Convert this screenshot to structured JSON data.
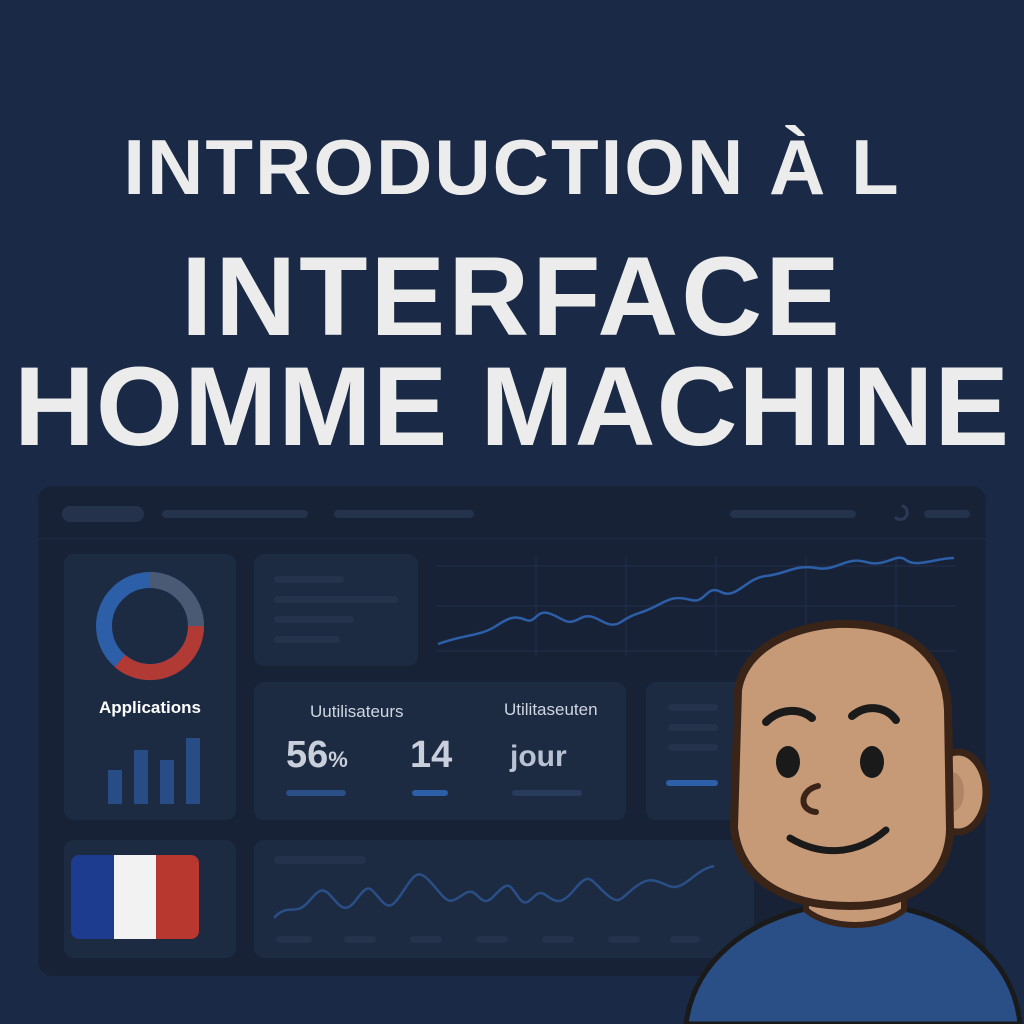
{
  "title": {
    "line1": "INTRODUCTION À L",
    "line2": "INTERFACE",
    "line3": "HOMME MACHINE"
  },
  "dashboard": {
    "apps_label": "Applications",
    "metrics": {
      "label_left": "Uutilisateurs",
      "label_right": "Utilitaseuten",
      "value_percent": "56",
      "percent_sign": "%",
      "value_count": "14",
      "value_word": "jour"
    }
  },
  "colors": {
    "background": "#1a2a46",
    "panel": "#172236",
    "card": "#1c2a42",
    "accent_blue": "#2d5ea8",
    "accent_red": "#b23a35",
    "flag_blue": "#1d3b8f",
    "flag_white": "#f2f2f2",
    "flag_red": "#b8372f",
    "avatar_skin": "#c79a77",
    "avatar_shirt": "#2a4f86"
  },
  "icons": [
    "donut-chart-icon",
    "bar-chart-icon",
    "france-flag-icon",
    "avatar-illustration"
  ]
}
